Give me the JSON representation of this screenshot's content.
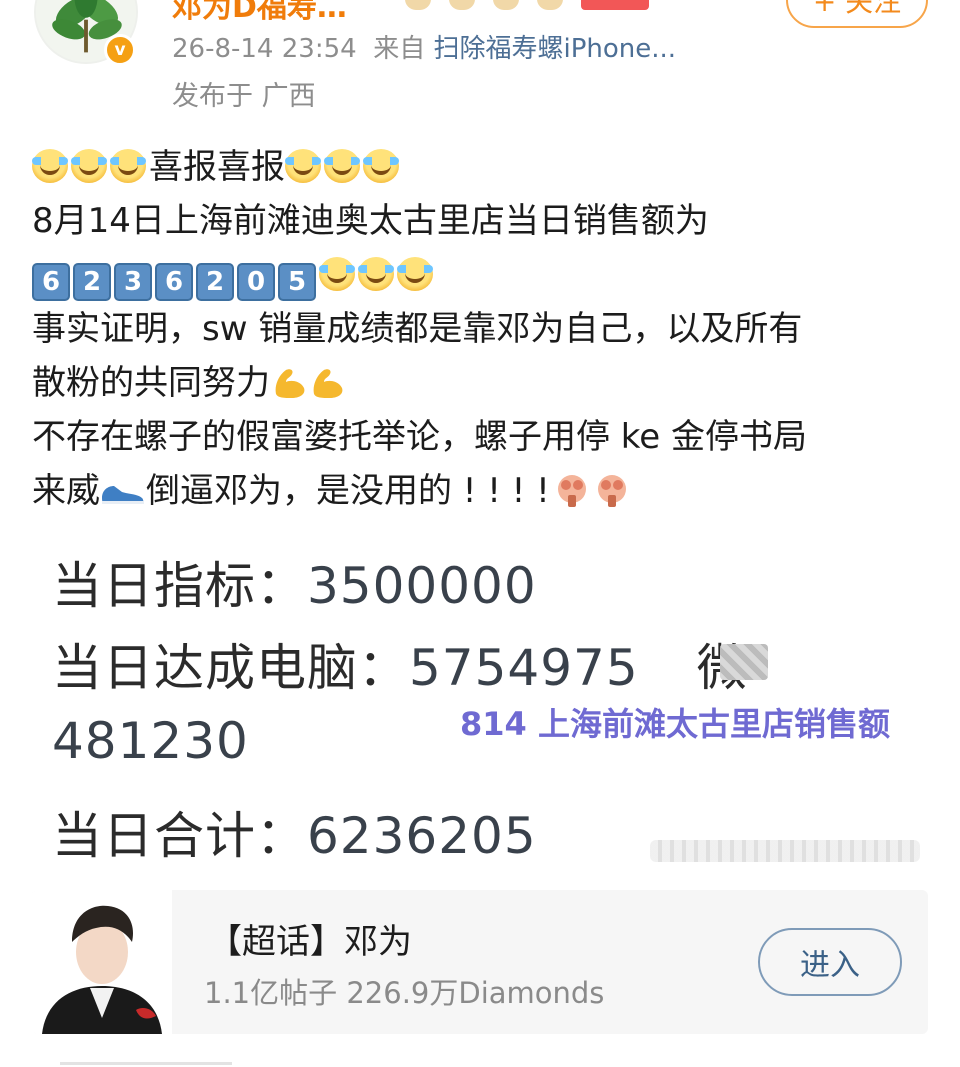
{
  "header": {
    "user_name": "邓为D福寿…",
    "timestamp": "26-8-14 23:54",
    "source_prefix": "来自",
    "source_name": "扫除福寿螺iPhone...",
    "location": "发布于 广西",
    "follow_label": "+ 关注",
    "verified_mark": "v"
  },
  "post": {
    "line1_text": "喜报喜报",
    "line2_text": "8月14日上海前滩迪奥太古里店当日销售额为",
    "digits": [
      "6",
      "2",
      "3",
      "6",
      "2",
      "0",
      "5"
    ],
    "line4_text": "事实证明，sw 销量成绩都是靠邓为自己，以及所有",
    "line5_text": "散粉的共同努力",
    "line6_text": "不存在螺子的假富婆托举论，螺子用停 ke 金停书局",
    "line7_prefix": "来威",
    "line7_suffix": "倒逼邓为，是没用的 ! ! ! !"
  },
  "image": {
    "target_label": "当日指标：",
    "target_value": "3500000",
    "pc_label": "当日达成电脑：",
    "pc_value": "5754975",
    "weixin_label": "微",
    "weixin_value": "481230",
    "total_label": "当日合计：",
    "total_value": "6236205",
    "overlay_text": "814 上海前滩太古里店销售额"
  },
  "topic_card": {
    "title": "【超话】邓为",
    "stats": "1.1亿帖子 226.9万Diamonds",
    "enter_label": "进入"
  },
  "colors": {
    "username": "#f07c0a",
    "source_link": "#4d6f95",
    "overlay": "#6f6ad2",
    "keycap": "#5b8fc5"
  }
}
